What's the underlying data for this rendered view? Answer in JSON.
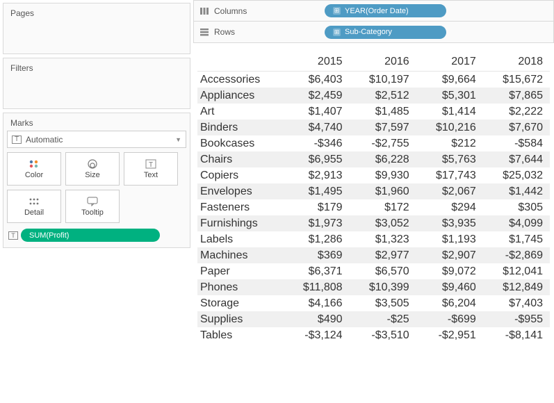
{
  "panels": {
    "pages": "Pages",
    "filters": "Filters",
    "marks": "Marks"
  },
  "marks": {
    "type": "Automatic",
    "cards": {
      "color": "Color",
      "size": "Size",
      "text": "Text",
      "detail": "Detail",
      "tooltip": "Tooltip"
    },
    "pill": "SUM(Profit)"
  },
  "shelves": {
    "columns_label": "Columns",
    "rows_label": "Rows",
    "columns_pill": "YEAR(Order Date)",
    "rows_pill": "Sub-Category"
  },
  "chart_data": {
    "type": "table",
    "columns": [
      "2015",
      "2016",
      "2017",
      "2018"
    ],
    "rows": [
      {
        "name": "Accessories",
        "values": [
          "$6,403",
          "$10,197",
          "$9,664",
          "$15,672"
        ]
      },
      {
        "name": "Appliances",
        "values": [
          "$2,459",
          "$2,512",
          "$5,301",
          "$7,865"
        ]
      },
      {
        "name": "Art",
        "values": [
          "$1,407",
          "$1,485",
          "$1,414",
          "$2,222"
        ]
      },
      {
        "name": "Binders",
        "values": [
          "$4,740",
          "$7,597",
          "$10,216",
          "$7,670"
        ]
      },
      {
        "name": "Bookcases",
        "values": [
          "-$346",
          "-$2,755",
          "$212",
          "-$584"
        ]
      },
      {
        "name": "Chairs",
        "values": [
          "$6,955",
          "$6,228",
          "$5,763",
          "$7,644"
        ]
      },
      {
        "name": "Copiers",
        "values": [
          "$2,913",
          "$9,930",
          "$17,743",
          "$25,032"
        ]
      },
      {
        "name": "Envelopes",
        "values": [
          "$1,495",
          "$1,960",
          "$2,067",
          "$1,442"
        ]
      },
      {
        "name": "Fasteners",
        "values": [
          "$179",
          "$172",
          "$294",
          "$305"
        ]
      },
      {
        "name": "Furnishings",
        "values": [
          "$1,973",
          "$3,052",
          "$3,935",
          "$4,099"
        ]
      },
      {
        "name": "Labels",
        "values": [
          "$1,286",
          "$1,323",
          "$1,193",
          "$1,745"
        ]
      },
      {
        "name": "Machines",
        "values": [
          "$369",
          "$2,977",
          "$2,907",
          "-$2,869"
        ]
      },
      {
        "name": "Paper",
        "values": [
          "$6,371",
          "$6,570",
          "$9,072",
          "$12,041"
        ]
      },
      {
        "name": "Phones",
        "values": [
          "$11,808",
          "$10,399",
          "$9,460",
          "$12,849"
        ]
      },
      {
        "name": "Storage",
        "values": [
          "$4,166",
          "$3,505",
          "$6,204",
          "$7,403"
        ]
      },
      {
        "name": "Supplies",
        "values": [
          "$490",
          "-$25",
          "-$699",
          "-$955"
        ]
      },
      {
        "name": "Tables",
        "values": [
          "-$3,124",
          "-$3,510",
          "-$2,951",
          "-$8,141"
        ]
      }
    ]
  }
}
